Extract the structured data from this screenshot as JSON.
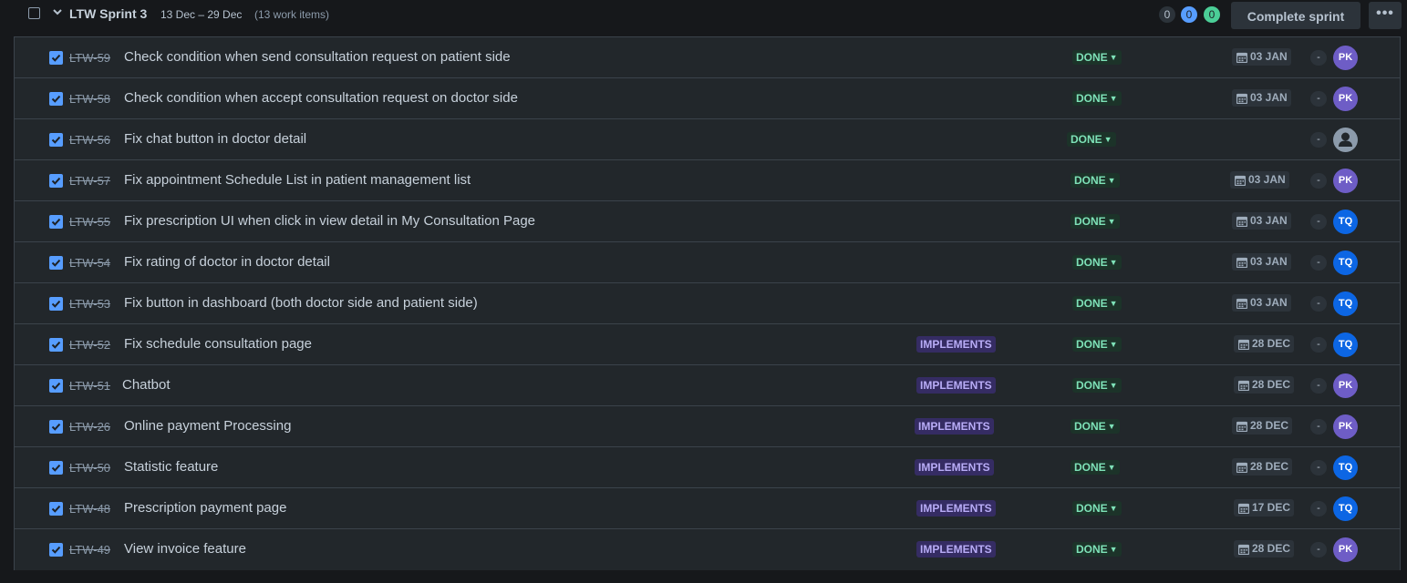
{
  "sprint": {
    "name": "LTW Sprint 3",
    "dates": "13 Dec – 29 Dec",
    "work_items": "(13 work items)",
    "counts": {
      "todo": "0",
      "in_progress": "0",
      "done": "0"
    },
    "complete_label": "Complete sprint",
    "more_label": "•••"
  },
  "colors": {
    "checkbox": "#579dff",
    "done_status_bg": "#1c3329",
    "done_status_text": "#7ee2b8",
    "label_bg": "#352c63",
    "label_text": "#b8acf6",
    "avatar_pk": "#6e5dc6",
    "avatar_tq": "#0c66e4"
  },
  "issues": [
    {
      "key": "LTW-59",
      "summary": "Check condition when send consultation request on patient side",
      "label": "",
      "status": "DONE",
      "due": "03 JAN",
      "estimate": "-",
      "assignee": "PK"
    },
    {
      "key": "LTW-58",
      "summary": "Check condition when accept consultation request on doctor side",
      "label": "",
      "status": "DONE",
      "due": "03 JAN",
      "estimate": "-",
      "assignee": "PK"
    },
    {
      "key": "LTW-56",
      "summary": "Fix chat button in doctor detail",
      "label": "",
      "status": "DONE",
      "due": "",
      "estimate": "-",
      "assignee": ""
    },
    {
      "key": "LTW-57",
      "summary": "Fix appointment Schedule List in patient management list",
      "label": "",
      "status": "DONE",
      "due": "03 JAN",
      "estimate": "-",
      "assignee": "PK"
    },
    {
      "key": "LTW-55",
      "summary": "Fix prescription UI when click in view detail in My Consultation Page",
      "label": "",
      "status": "DONE",
      "due": "03 JAN",
      "estimate": "-",
      "assignee": "TQ"
    },
    {
      "key": "LTW-54",
      "summary": "Fix rating of doctor in doctor detail",
      "label": "",
      "status": "DONE",
      "due": "03 JAN",
      "estimate": "-",
      "assignee": "TQ"
    },
    {
      "key": "LTW-53",
      "summary": "Fix button in dashboard (both doctor side and patient side)",
      "label": "",
      "status": "DONE",
      "due": "03 JAN",
      "estimate": "-",
      "assignee": "TQ"
    },
    {
      "key": "LTW-52",
      "summary": "Fix schedule consultation page",
      "label": "IMPLEMENTS",
      "status": "DONE",
      "due": "28 DEC",
      "estimate": "-",
      "assignee": "TQ"
    },
    {
      "key": "LTW-51",
      "summary": "Chatbot",
      "label": "IMPLEMENTS",
      "status": "DONE",
      "due": "28 DEC",
      "estimate": "-",
      "assignee": "PK"
    },
    {
      "key": "LTW-26",
      "summary": "Online payment Processing",
      "label": "IMPLEMENTS",
      "status": "DONE",
      "due": "28 DEC",
      "estimate": "-",
      "assignee": "PK"
    },
    {
      "key": "LTW-50",
      "summary": "Statistic feature",
      "label": "IMPLEMENTS",
      "status": "DONE",
      "due": "28 DEC",
      "estimate": "-",
      "assignee": "TQ"
    },
    {
      "key": "LTW-48",
      "summary": "Prescription payment page",
      "label": "IMPLEMENTS",
      "status": "DONE",
      "due": "17 DEC",
      "estimate": "-",
      "assignee": "TQ"
    },
    {
      "key": "LTW-49",
      "summary": "View invoice feature",
      "label": "IMPLEMENTS",
      "status": "DONE",
      "due": "28 DEC",
      "estimate": "-",
      "assignee": "PK"
    }
  ]
}
